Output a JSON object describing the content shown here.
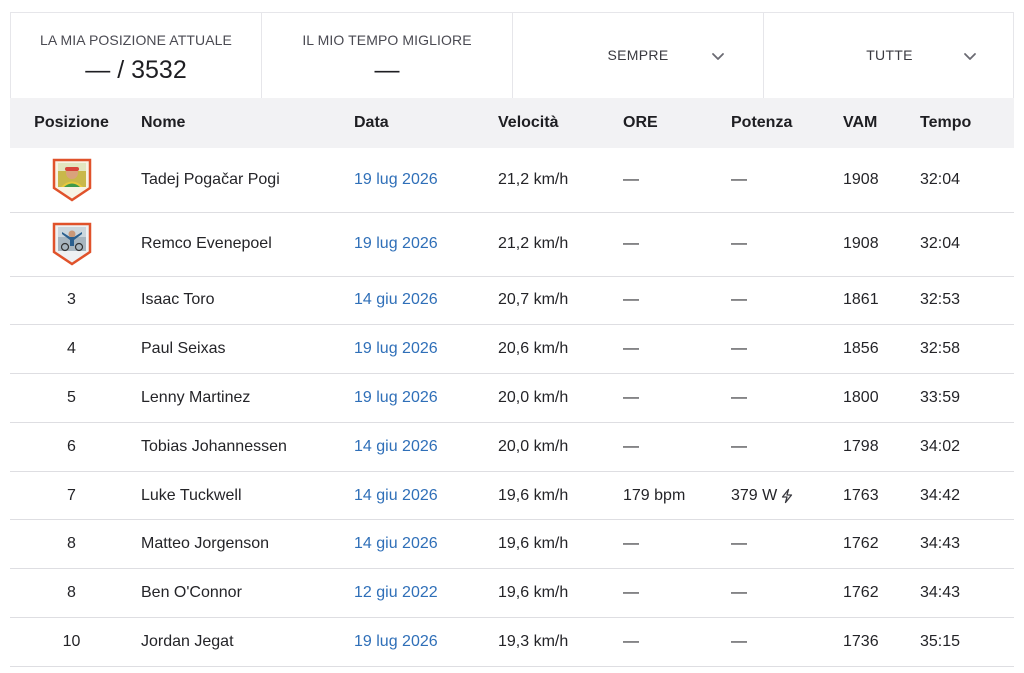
{
  "summary": {
    "position_label": "LA MIA POSIZIONE ATTUALE",
    "position_value": "— / 3532",
    "best_time_label": "IL MIO TEMPO MIGLIORE",
    "best_time_value": "—",
    "filter_period": "SEMPRE",
    "filter_group": "TUTTE"
  },
  "table": {
    "headers": {
      "pos": "Posizione",
      "name": "Nome",
      "date": "Data",
      "speed": "Velocità",
      "ore": "ORE",
      "power": "Potenza",
      "vam": "VAM",
      "time": "Tempo"
    },
    "rows": [
      {
        "pos": "",
        "badge": "rider-photo-badge",
        "name": "Tadej Pogačar Pogi",
        "date": "19 lug 2026",
        "speed": "21,2 km/h",
        "ore": "—",
        "power": "—",
        "vam": "1908",
        "time": "32:04"
      },
      {
        "pos": "",
        "badge": "rider-photo-badge",
        "name": "Remco Evenepoel",
        "date": "19 lug 2026",
        "speed": "21,2 km/h",
        "ore": "—",
        "power": "—",
        "vam": "1908",
        "time": "32:04"
      },
      {
        "pos": "3",
        "name": "Isaac Toro",
        "date": "14 giu 2026",
        "speed": "20,7 km/h",
        "ore": "—",
        "power": "—",
        "vam": "1861",
        "time": "32:53"
      },
      {
        "pos": "4",
        "name": "Paul Seixas",
        "date": "19 lug 2026",
        "speed": "20,6 km/h",
        "ore": "—",
        "power": "—",
        "vam": "1856",
        "time": "32:58"
      },
      {
        "pos": "5",
        "name": "Lenny Martinez",
        "date": "19 lug 2026",
        "speed": "20,0 km/h",
        "ore": "—",
        "power": "—",
        "vam": "1800",
        "time": "33:59"
      },
      {
        "pos": "6",
        "name": "Tobias Johannessen",
        "date": "14 giu 2026",
        "speed": "20,0 km/h",
        "ore": "—",
        "power": "—",
        "vam": "1798",
        "time": "34:02"
      },
      {
        "pos": "7",
        "name": "Luke Tuckwell",
        "date": "14 giu 2026",
        "speed": "19,6 km/h",
        "ore": "179 bpm",
        "power": "379 W",
        "power_icon": "lightning-bolt-icon",
        "vam": "1763",
        "time": "34:42"
      },
      {
        "pos": "8",
        "name": "Matteo Jorgenson",
        "date": "14 giu 2026",
        "speed": "19,6 km/h",
        "ore": "—",
        "power": "—",
        "vam": "1762",
        "time": "34:43"
      },
      {
        "pos": "8",
        "name": "Ben O'Connor",
        "date": "12 giu 2022",
        "speed": "19,6 km/h",
        "ore": "—",
        "power": "—",
        "vam": "1762",
        "time": "34:43"
      },
      {
        "pos": "10",
        "name": "Jordan Jegat",
        "date": "19 lug 2026",
        "speed": "19,3 km/h",
        "ore": "—",
        "power": "—",
        "vam": "1736",
        "time": "35:15"
      }
    ]
  },
  "colors": {
    "link": "#2f6fb8",
    "header_bg": "#f2f2f4",
    "badge_border": "#e0522b"
  }
}
